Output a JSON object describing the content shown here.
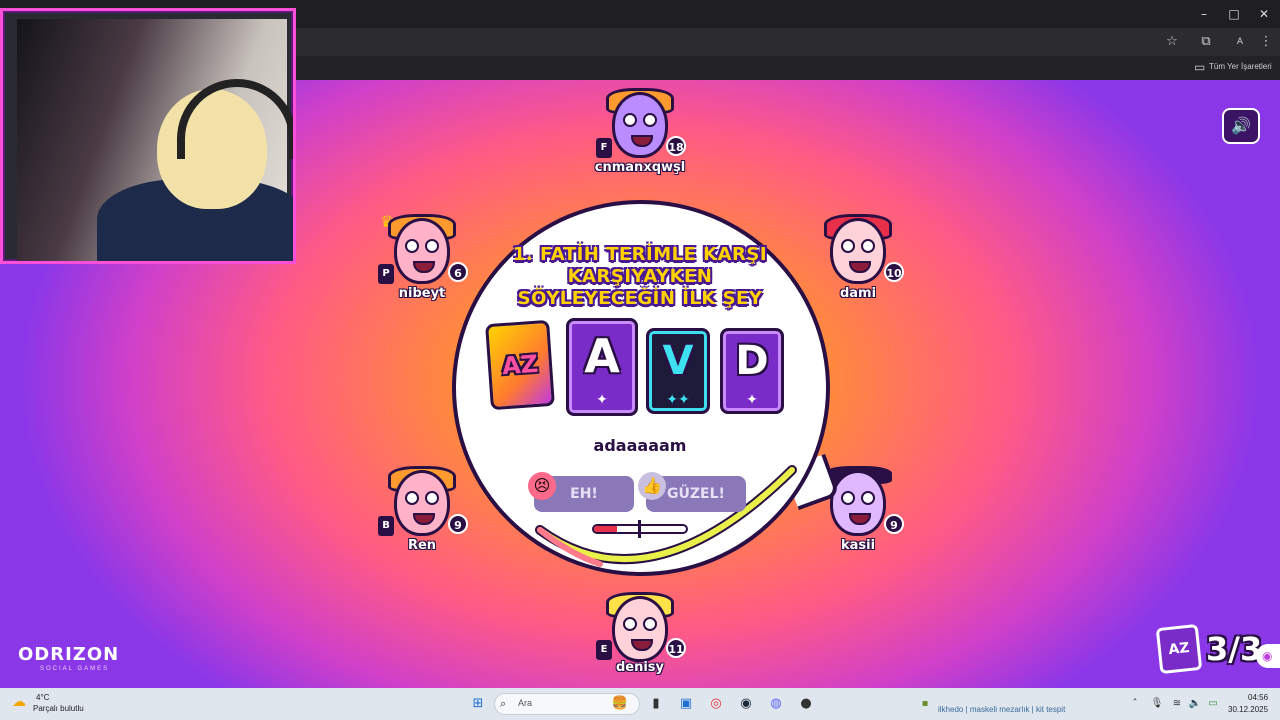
{
  "browser": {
    "window_controls": {
      "minimize": "–",
      "maximize": "□",
      "close": "✕"
    },
    "toolbar_icons": [
      "star-icon",
      "extensions-icon",
      "profile-icon",
      "menu-icon"
    ],
    "profile_initial": "A",
    "bookmarks_label": "Tüm Yer İşaretleri"
  },
  "game": {
    "question": "1. FATİH TERİMLE KARŞI KARŞIYAYKEN SÖYLEYECEĞİN İLK ŞEY",
    "cards": [
      {
        "letter": "AZ",
        "sparks": ""
      },
      {
        "letter": "A",
        "sparks": "✦"
      },
      {
        "letter": "V",
        "sparks": "✦✦"
      },
      {
        "letter": "D",
        "sparks": "✦"
      }
    ],
    "answer": "adaaaaam",
    "vote": {
      "bad_label": "EH!",
      "good_label": "GÜZEL!",
      "meter_fraction": 0.25
    },
    "round": {
      "text": "3/3",
      "icon_text": "AZ"
    },
    "sound_icon": "speaker-icon",
    "logo": {
      "name": "ODRIZON",
      "sub": "SOCIAL GAMES"
    }
  },
  "players": [
    {
      "name": "cnmanxqwşl",
      "score": "18",
      "badge": "F"
    },
    {
      "name": "nibeyt",
      "score": "6",
      "badge": "P"
    },
    {
      "name": "dami",
      "score": "10",
      "badge": ""
    },
    {
      "name": "Ren",
      "score": "9",
      "badge": "B"
    },
    {
      "name": "kasii",
      "score": "9",
      "badge": ""
    },
    {
      "name": "denisy",
      "score": "11",
      "badge": "E"
    }
  ],
  "taskbar": {
    "weather_temp": "4°C",
    "weather_desc": "Parçalı bulutlu",
    "search_label": "Ara",
    "tray_text": "ilkhedo | maskeli mezarlık | kit tespit",
    "time": "04:56",
    "date": "30.12.2025"
  },
  "colors": {
    "accent_dark": "#2a0f45",
    "question_yellow": "#ffd200",
    "card_purple": "#7a2cc9",
    "card_cyan": "#3ee0f0"
  }
}
